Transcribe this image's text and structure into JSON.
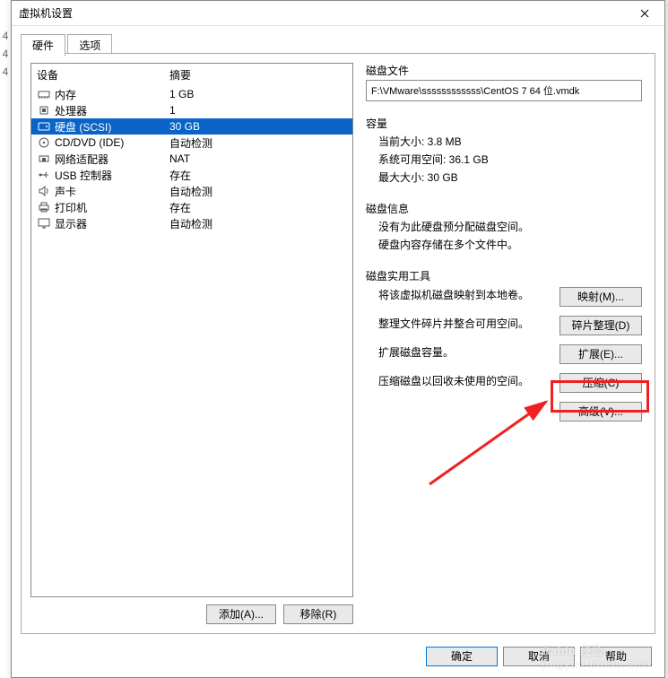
{
  "window": {
    "title": "虚拟机设置"
  },
  "tabs": {
    "hardware": "硬件",
    "options": "选项"
  },
  "device_header": {
    "device": "设备",
    "summary": "摘要"
  },
  "devices": [
    {
      "icon": "memory",
      "name": "内存",
      "summary": "1 GB"
    },
    {
      "icon": "cpu",
      "name": "处理器",
      "summary": "1"
    },
    {
      "icon": "disk",
      "name": "硬盘 (SCSI)",
      "summary": "30 GB",
      "selected": true
    },
    {
      "icon": "cd",
      "name": "CD/DVD (IDE)",
      "summary": "自动检测"
    },
    {
      "icon": "net",
      "name": "网络适配器",
      "summary": "NAT"
    },
    {
      "icon": "usb",
      "name": "USB 控制器",
      "summary": "存在"
    },
    {
      "icon": "sound",
      "name": "声卡",
      "summary": "自动检测"
    },
    {
      "icon": "printer",
      "name": "打印机",
      "summary": "存在"
    },
    {
      "icon": "display",
      "name": "显示器",
      "summary": "自动检测"
    }
  ],
  "left_buttons": {
    "add": "添加(A)...",
    "remove": "移除(R)"
  },
  "disk": {
    "file_section": "磁盘文件",
    "file_path": "F:\\VMware\\ssssssssssss\\CentOS 7 64 位.vmdk",
    "capacity_section": "容量",
    "current_size_label": "当前大小: 3.8 MB",
    "free_space_label": "系统可用空间: 36.1 GB",
    "max_size_label": "最大大小: 30 GB",
    "info_section": "磁盘信息",
    "info_line1": "没有为此硬盘预分配磁盘空间。",
    "info_line2": "硬盘内容存储在多个文件中。",
    "util_section": "磁盘实用工具",
    "util_map_desc": "将该虚拟机磁盘映射到本地卷。",
    "util_map_btn": "映射(M)...",
    "util_defrag_desc": "整理文件碎片并整合可用空间。",
    "util_defrag_btn": "碎片整理(D)",
    "util_expand_desc": "扩展磁盘容量。",
    "util_expand_btn": "扩展(E)...",
    "util_compact_desc": "压缩磁盘以回收未使用的空间。",
    "util_compact_btn": "压缩(C)",
    "advanced_btn": "高级(V)..."
  },
  "footer": {
    "ok": "确定",
    "cancel": "取消",
    "help": "帮助"
  },
  "watermark": {
    "main": "Baidu 经验",
    "sub": "jingyan.baidu.com"
  }
}
